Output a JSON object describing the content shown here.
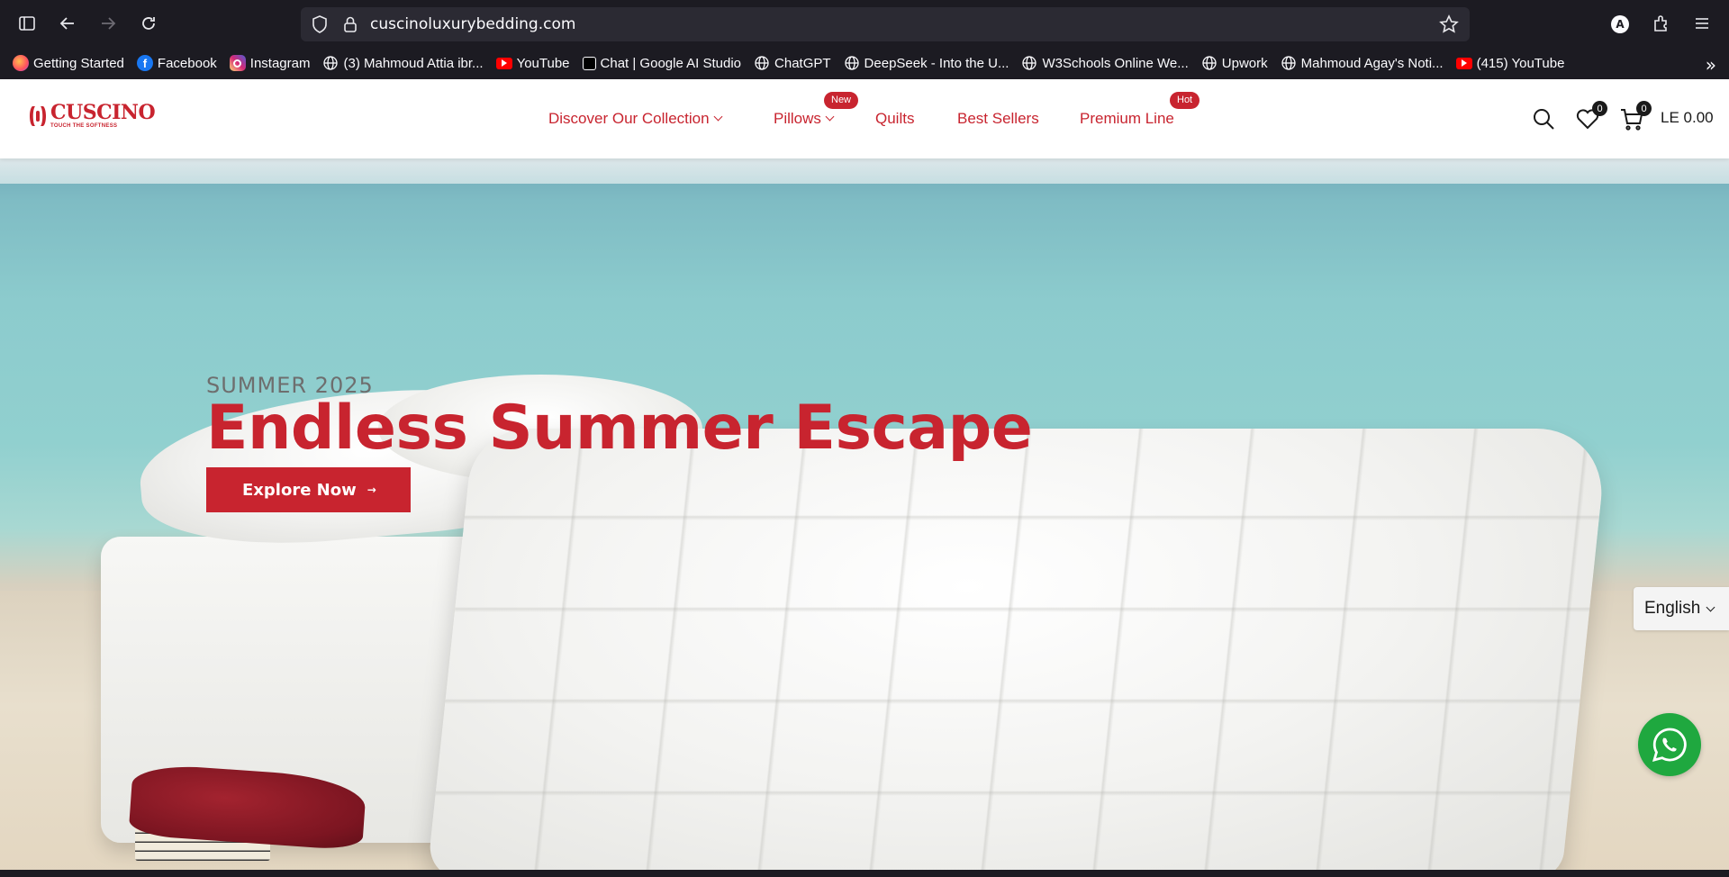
{
  "browser": {
    "url": "cuscinoluxurybedding.com",
    "profile_initial": "A",
    "bookmarks": [
      {
        "label": "Getting Started",
        "icon": "firefox-icon"
      },
      {
        "label": "Facebook",
        "icon": "facebook-icon"
      },
      {
        "label": "Instagram",
        "icon": "instagram-icon"
      },
      {
        "label": "(3) Mahmoud Attia ibr...",
        "icon": "globe-icon"
      },
      {
        "label": "YouTube",
        "icon": "youtube-icon"
      },
      {
        "label": "Chat | Google AI Studio",
        "icon": "ai-studio-icon"
      },
      {
        "label": "ChatGPT",
        "icon": "globe-icon"
      },
      {
        "label": "DeepSeek - Into the U...",
        "icon": "globe-icon"
      },
      {
        "label": "W3Schools Online We...",
        "icon": "globe-icon"
      },
      {
        "label": "Upwork",
        "icon": "globe-icon"
      },
      {
        "label": "Mahmoud Agay's Noti...",
        "icon": "globe-icon"
      },
      {
        "label": "(415) YouTube",
        "icon": "youtube-icon"
      }
    ]
  },
  "site": {
    "logo": {
      "name": "CUSCINO",
      "tagline": "TOUCH THE SOFTNESS"
    },
    "nav": [
      {
        "label": "Discover Our Collection",
        "has_dropdown": true,
        "badge": ""
      },
      {
        "label": "Pillows",
        "has_dropdown": true,
        "badge": "New"
      },
      {
        "label": "Quilts",
        "has_dropdown": false,
        "badge": ""
      },
      {
        "label": "Best Sellers",
        "has_dropdown": false,
        "badge": ""
      },
      {
        "label": "Premium Line",
        "has_dropdown": false,
        "badge": "Hot"
      }
    ],
    "wishlist_count": "0",
    "cart_count": "0",
    "cart_total": "LE 0.00"
  },
  "hero": {
    "eyebrow": "SUMMER 2025",
    "title": "Endless Summer Escape",
    "cta_label": "Explore Now",
    "cta_arrow": "→"
  },
  "language": {
    "selected": "English"
  },
  "colors": {
    "brand_red": "#c8242f",
    "whatsapp_green": "#1fa83f",
    "chrome_bg": "#1c1b22"
  }
}
